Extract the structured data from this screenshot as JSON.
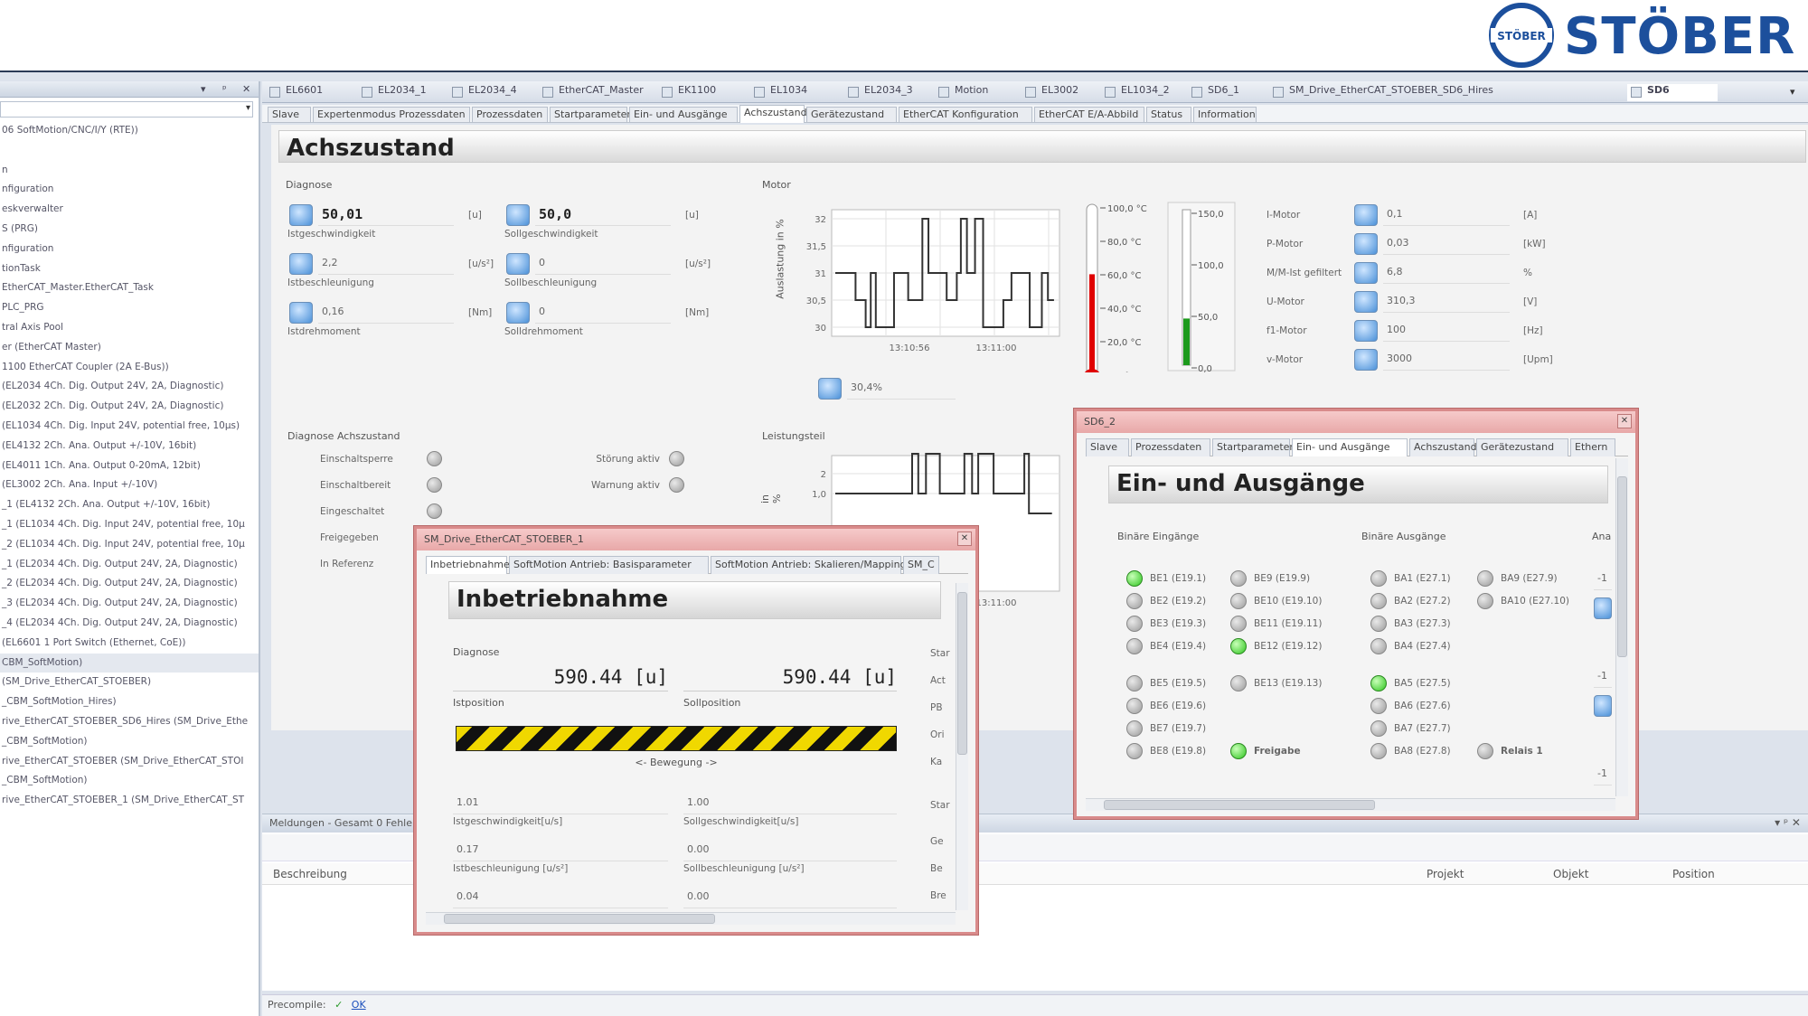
{
  "logo": {
    "text": "STÖBER",
    "seal_text": "STÖBER",
    "brand_color": "#1c4f9c"
  },
  "sidebar": {
    "head_controls": [
      "▾",
      "ᵖ",
      "✕"
    ],
    "items": [
      "06 SoftMotion/CNC/I/Y (RTE))",
      "",
      "n",
      "nfiguration",
      "eskverwalter",
      "S (PRG)",
      "nfiguration",
      "tionTask",
      "EtherCAT_Master.EtherCAT_Task",
      "PLC_PRG",
      "tral Axis Pool",
      "er (EtherCAT Master)",
      "1100 EtherCAT Coupler (2A E-Bus))",
      "(EL2034 4Ch. Dig. Output 24V, 2A, Diagnostic)",
      "(EL2032 2Ch. Dig. Output 24V, 2A, Diagnostic)",
      "(EL1034 4Ch. Dig. Input 24V, potential free, 10µs)",
      "(EL4132 2Ch. Ana. Output +/-10V, 16bit)",
      "(EL4011 1Ch. Ana. Output 0-20mA, 12bit)",
      "(EL3002 2Ch. Ana. Input +/-10V)",
      "_1 (EL4132 2Ch. Ana. Output +/-10V, 16bit)",
      "_1 (EL1034 4Ch. Dig. Input 24V, potential free, 10µ",
      "_2 (EL1034 4Ch. Dig. Input 24V, potential free, 10µ",
      "_1 (EL2034 4Ch. Dig. Output 24V, 2A, Diagnostic)",
      "_2 (EL2034 4Ch. Dig. Output 24V, 2A, Diagnostic)",
      "_3 (EL2034 4Ch. Dig. Output 24V, 2A, Diagnostic)",
      "_4 (EL2034 4Ch. Dig. Output 24V, 2A, Diagnostic)",
      "(EL6601 1 Port Switch (Ethernet, CoE))",
      "CBM_SoftMotion)",
      "(SM_Drive_EtherCAT_STOEBER)",
      "_CBM_SoftMotion_Hires)",
      "rive_EtherCAT_STOEBER_SD6_Hires (SM_Drive_Ethe",
      "_CBM_SoftMotion)",
      "rive_EtherCAT_STOEBER (SM_Drive_EtherCAT_STOI",
      "_CBM_SoftMotion)",
      "rive_EtherCAT_STOEBER_1 (SM_Drive_EtherCAT_ST"
    ]
  },
  "doc_tabs": [
    "EL6601",
    "EL2034_1",
    "EL2034_4",
    "EtherCAT_Master",
    "EK1100",
    "EL1034",
    "EL2034_3",
    "Motion",
    "EL3002",
    "EL1034_2",
    "SD6_1",
    "SM_Drive_EtherCAT_STOEBER_SD6_Hires",
    "SD6"
  ],
  "sub_tabs": [
    "Slave",
    "Expertenmodus Prozessdaten",
    "Prozessdaten",
    "Startparameter",
    "Ein- und Ausgänge",
    "Achszustand",
    "Gerätezustand",
    "EtherCAT Konfiguration",
    "EtherCAT E/A-Abbild",
    "Status",
    "Information"
  ],
  "achs": {
    "title": "Achszustand",
    "diag_label": "Diagnose",
    "rows": [
      {
        "a_val": "50,01",
        "a_unit": "[u]",
        "a_label": "Istgeschwindigkeit",
        "b_val": "50,0",
        "b_unit": "[u]",
        "b_label": "Sollgeschwindigkeit"
      },
      {
        "a_val": "2,2",
        "a_unit": "[u/s²]",
        "a_label": "Istbeschleunigung",
        "b_val": "0",
        "b_unit": "[u/s²]",
        "b_label": "Sollbeschleunigung"
      },
      {
        "a_val": "0,16",
        "a_unit": "[Nm]",
        "a_label": "Istdrehmoment",
        "b_val": "0",
        "b_unit": "[Nm]",
        "b_label": "Solldrehmoment"
      }
    ],
    "motor_label": "Motor",
    "motor_ylabel": "Auslastung in %",
    "motor_yticks": [
      "32",
      "31,5",
      "31",
      "30,5",
      "30"
    ],
    "motor_xticks": [
      "13:10:56",
      "13:11:00"
    ],
    "motor_value": "30,4%",
    "thermo_ticks": [
      "100,0 °C",
      "80,0 °C",
      "60,0 °C",
      "40,0 °C",
      "20,0 °C",
      "0,0 °C"
    ],
    "thermo_level": 0.57,
    "bar_ticks": [
      "150,0",
      "100,0",
      "50,0",
      "0,0"
    ],
    "bar_level": 0.3,
    "params": [
      {
        "label": "I-Motor",
        "value": "0,1",
        "unit": "[A]"
      },
      {
        "label": "P-Motor",
        "value": "0,03",
        "unit": "[kW]"
      },
      {
        "label": "M/M-Ist gefiltert",
        "value": "6,8",
        "unit": "%"
      },
      {
        "label": "U-Motor",
        "value": "310,3",
        "unit": "[V]"
      },
      {
        "label": "f1-Motor",
        "value": "100",
        "unit": "[Hz]"
      },
      {
        "label": "v-Motor",
        "value": "3000",
        "unit": "[Upm]"
      }
    ],
    "diag_axis_label": "Diagnose Achszustand",
    "states_left": [
      "Einschaltsperre",
      "Einschaltbereit",
      "Eingeschaltet",
      "Freigegeben",
      "In Referenz"
    ],
    "states_right": [
      "Störung aktiv",
      "Warnung aktiv"
    ],
    "power_label": "Leistungsteil",
    "power_ylabel": "in %",
    "power_yticks": [
      "2",
      "1,0"
    ],
    "power_xtick": "13:11:00"
  },
  "win_sm": {
    "title": "SM_Drive_EtherCAT_STOEBER_1",
    "tabs": [
      "Inbetriebnahme",
      "SoftMotion Antrieb: Basisparameter",
      "SoftMotion Antrieb: Skalieren/Mapping",
      "SM_C"
    ],
    "head": "Inbetriebnahme",
    "diag": "Diagnose",
    "ist_pos": "590.44 [u]",
    "ist_pos_label": "Istposition",
    "soll_pos": "590.44 [u]",
    "soll_pos_label": "Sollposition",
    "movement": "<- Bewegung ->",
    "fields": [
      {
        "a": "1.01",
        "a_label": "Istgeschwindigkeit[u/s]",
        "b": "1.00",
        "b_label": "Sollgeschwindigkeit[u/s]"
      },
      {
        "a": "0.17",
        "a_label": "Istbeschleunigung [u/s²]",
        "b": "0.00",
        "b_label": "Sollbeschleunigung [u/s²]"
      },
      {
        "a": "0.04",
        "a_label": "",
        "b": "0.00",
        "b_label": ""
      }
    ],
    "right_col": [
      "Star",
      "Act",
      "PB",
      "Ori",
      "Ka",
      "Star",
      "Ge",
      "Be",
      "Bre"
    ]
  },
  "win_sd6": {
    "title": "SD6_2",
    "tabs": [
      "Slave",
      "Prozessdaten",
      "Startparameter",
      "Ein- und Ausgänge",
      "Achszustand",
      "Gerätezustand",
      "Ethern"
    ],
    "head": "Ein- und Ausgänge",
    "in_label": "Binäre Eingänge",
    "out_label": "Binäre Ausgänge",
    "ana_label": "Ana",
    "in_col1": [
      {
        "t": "BE1 (E19.1)",
        "on": true
      },
      {
        "t": "BE2 (E19.2)",
        "on": false
      },
      {
        "t": "BE3 (E19.3)",
        "on": false
      },
      {
        "t": "BE4 (E19.4)",
        "on": false
      },
      {
        "t": "BE5 (E19.5)",
        "on": false
      },
      {
        "t": "BE6 (E19.6)",
        "on": false
      },
      {
        "t": "BE7 (E19.7)",
        "on": false
      },
      {
        "t": "BE8 (E19.8)",
        "on": false
      }
    ],
    "in_col2": [
      {
        "t": "BE9 (E19.9)",
        "on": false
      },
      {
        "t": "BE10 (E19.10)",
        "on": false
      },
      {
        "t": "BE11 (E19.11)",
        "on": false
      },
      {
        "t": "BE12 (E19.12)",
        "on": true
      },
      {
        "t": "BE13 (E19.13)",
        "on": false
      },
      {
        "t": "Freigabe",
        "on": true
      }
    ],
    "out_col1": [
      {
        "t": "BA1 (E27.1)",
        "on": false
      },
      {
        "t": "BA2 (E27.2)",
        "on": false
      },
      {
        "t": "BA3 (E27.3)",
        "on": false
      },
      {
        "t": "BA4 (E27.4)",
        "on": false
      },
      {
        "t": "BA5 (E27.5)",
        "on": true
      },
      {
        "t": "BA6 (E27.6)",
        "on": false
      },
      {
        "t": "BA7 (E27.7)",
        "on": false
      },
      {
        "t": "BA8 (E27.8)",
        "on": false
      }
    ],
    "out_col2": [
      {
        "t": "BA9 (E27.9)",
        "on": false
      },
      {
        "t": "BA10 (E27.10)",
        "on": false
      },
      {
        "t": "Relais 1",
        "on": false
      }
    ],
    "ana_vals": [
      "-1",
      "-1",
      "-1"
    ]
  },
  "messages": {
    "title": "Meldungen - Gesamt 0 Fehler",
    "cols": [
      "Beschreibung",
      "Projekt",
      "Objekt",
      "Position"
    ]
  },
  "status": {
    "label": "Precompile:",
    "ok": "OK"
  }
}
